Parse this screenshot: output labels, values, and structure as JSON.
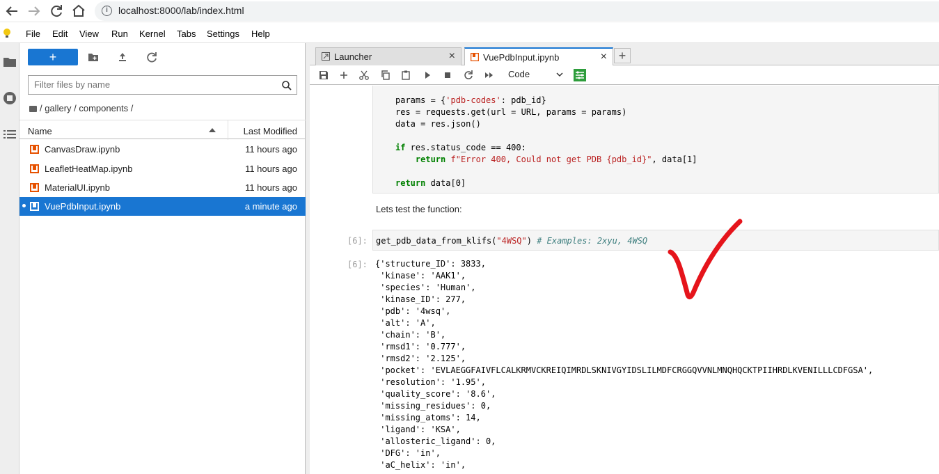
{
  "browser": {
    "url": "localhost:8000/lab/index.html",
    "info_glyph": "i"
  },
  "menu": {
    "items": [
      "File",
      "Edit",
      "View",
      "Run",
      "Kernel",
      "Tabs",
      "Settings",
      "Help"
    ]
  },
  "file_browser": {
    "new_label": "+",
    "filter_placeholder": "Filter files by name",
    "breadcrumb": "/ gallery / components /",
    "columns": {
      "name": "Name",
      "modified": "Last Modified"
    },
    "files": [
      {
        "name": "CanvasDraw.ipynb",
        "modified": "11 hours ago",
        "selected": false
      },
      {
        "name": "LeafletHeatMap.ipynb",
        "modified": "11 hours ago",
        "selected": false
      },
      {
        "name": "MaterialUI.ipynb",
        "modified": "11 hours ago",
        "selected": false
      },
      {
        "name": "VuePdbInput.ipynb",
        "modified": "a minute ago",
        "selected": true
      }
    ]
  },
  "tabs": [
    {
      "label": "Launcher",
      "close": "×"
    },
    {
      "label": "VuePdbInput.ipynb",
      "close": "×"
    }
  ],
  "add_tab": "+",
  "toolbar": {
    "cell_type": "Code"
  },
  "notebook": {
    "code_lines": [
      "params = {'pdb-codes': pdb_id}",
      "res = requests.get(url = URL, params = params)",
      "data = res.json()",
      "",
      "if res.status_code == 400:",
      "    return f\"Error 400, Could not get PDB {pdb_id}\", data[1]",
      "",
      "return data[0]"
    ],
    "markdown": "Lets test the function:",
    "in_prompt": "[6]:",
    "in_code_call": "get_pdb_data_from_klifs(",
    "in_code_arg": "\"4WSQ\"",
    "in_code_close": ") ",
    "in_code_comment": "# Examples: 2xyu, 4WSQ",
    "out_prompt": "[6]:",
    "output_lines": [
      "{'structure_ID': 3833,",
      " 'kinase': 'AAK1',",
      " 'species': 'Human',",
      " 'kinase_ID': 277,",
      " 'pdb': '4wsq',",
      " 'alt': 'A',",
      " 'chain': 'B',",
      " 'rmsd1': '0.777',",
      " 'rmsd2': '2.125',",
      " 'pocket': 'EVLAEGGFAIVFLCALKRMVCKREIQIMRDLSKNIVGYIDSLILMDFCRGGQVVNLMNQHQCKTPIIHRDLKVENILLLCDFGSA',",
      " 'resolution': '1.95',",
      " 'quality_score': '8.6',",
      " 'missing_residues': 0,",
      " 'missing_atoms': 14,",
      " 'ligand': 'KSA',",
      " 'allosteric_ligand': 0,",
      " 'DFG': 'in',",
      " 'aC_helix': 'in',"
    ]
  },
  "colors": {
    "accent": "#1976d2",
    "notebook_icon": "#e65100",
    "checkmark": "#e5141b"
  }
}
